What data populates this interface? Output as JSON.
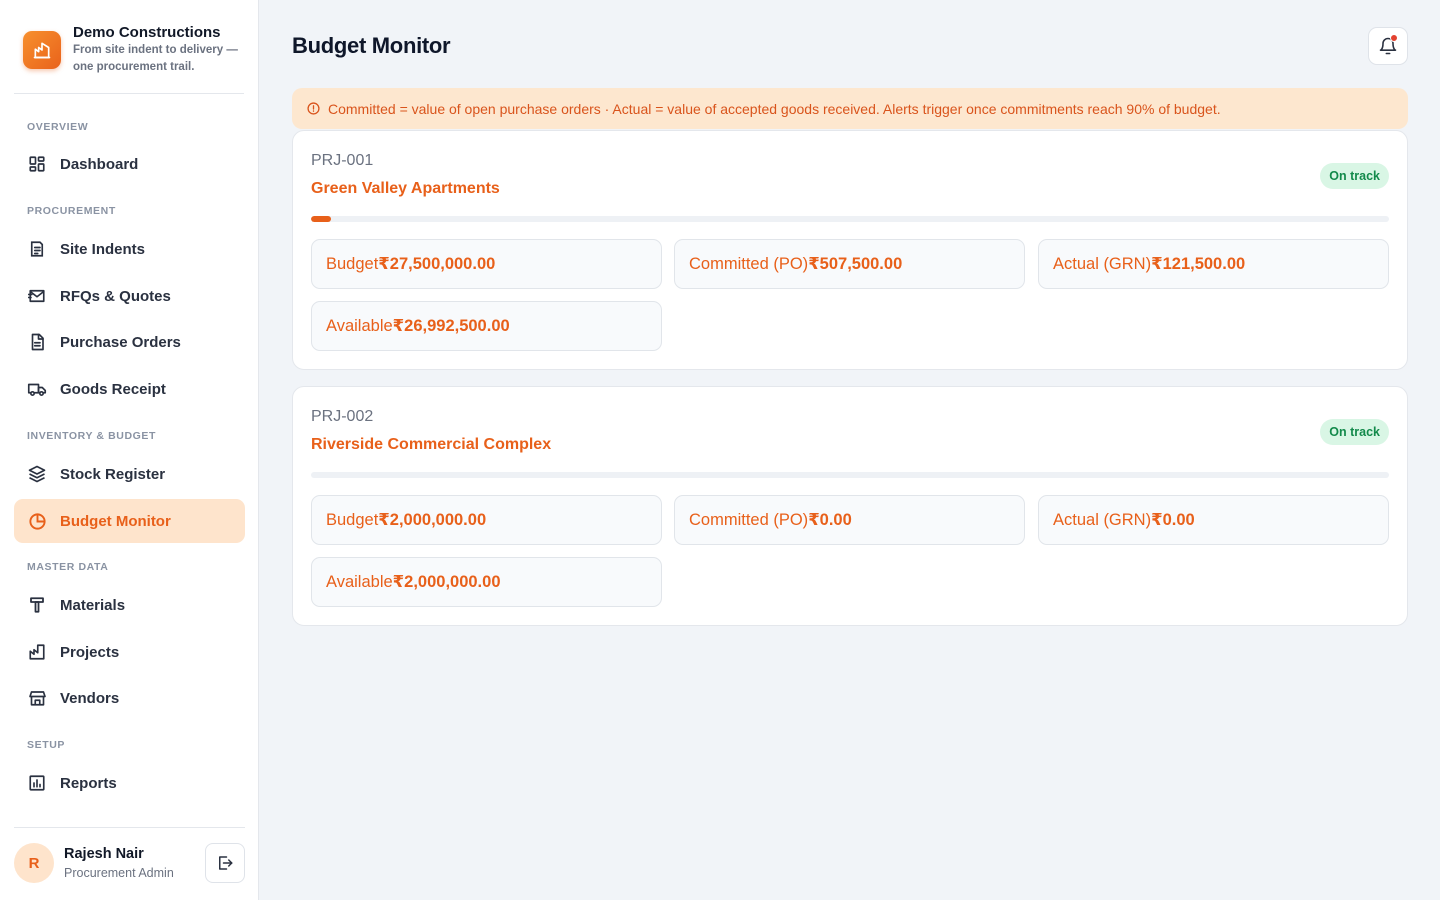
{
  "brand": {
    "name": "Demo Constructions",
    "tagline": "From site indent to delivery — one procurement trail."
  },
  "nav": {
    "overview": "OVERVIEW",
    "dashboard": "Dashboard",
    "procurement": "PROCUREMENT",
    "site_indents": "Site Indents",
    "rfqs": "RFQs & Quotes",
    "purchase_orders": "Purchase Orders",
    "goods_receipt": "Goods Receipt",
    "inventory_budget": "INVENTORY & BUDGET",
    "stock_register": "Stock Register",
    "budget_monitor": "Budget Monitor",
    "master_data": "MASTER DATA",
    "materials": "Materials",
    "projects": "Projects",
    "vendors": "Vendors",
    "setup": "SETUP",
    "reports": "Reports",
    "active": "budget_monitor"
  },
  "user": {
    "initial": "R",
    "name": "Rajesh Nair",
    "role": "Procurement Admin"
  },
  "page": {
    "title": "Budget Monitor",
    "notice": "Committed = value of open purchase orders · Actual = value of accepted goods received. Alerts trigger once commitments reach 90% of budget."
  },
  "colors": {
    "accent": "#e8601a",
    "on_track_bg": "#d9f6e5",
    "on_track_text": "#138a4b"
  },
  "projects": [
    {
      "code": "PRJ-001",
      "name": "Green Valley Apartments",
      "status": "On track",
      "committed_pct": 1.85,
      "budget_label": "Budget",
      "budget": "₹27,500,000.00",
      "committed_label": "Committed (PO)",
      "committed": "₹507,500.00",
      "actual_label": "Actual (GRN)",
      "actual": "₹121,500.00",
      "available_label": "Available",
      "available": "₹26,992,500.00"
    },
    {
      "code": "PRJ-002",
      "name": "Riverside Commercial Complex",
      "status": "On track",
      "committed_pct": 0,
      "budget_label": "Budget",
      "budget": "₹2,000,000.00",
      "committed_label": "Committed (PO)",
      "committed": "₹0.00",
      "actual_label": "Actual (GRN)",
      "actual": "₹0.00",
      "available_label": "Available",
      "available": "₹2,000,000.00"
    }
  ]
}
